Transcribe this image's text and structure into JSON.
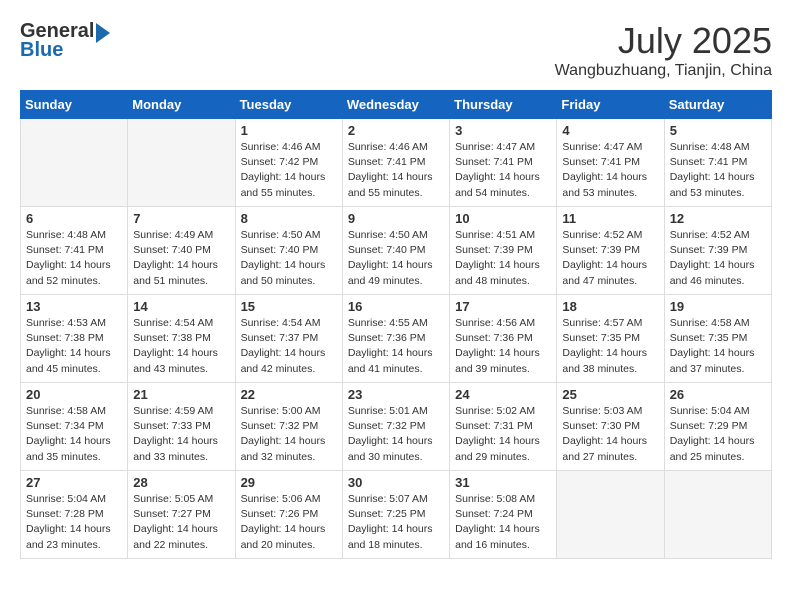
{
  "header": {
    "logo_general": "General",
    "logo_blue": "Blue",
    "month_title": "July 2025",
    "location": "Wangbuzhuang, Tianjin, China"
  },
  "weekdays": [
    "Sunday",
    "Monday",
    "Tuesday",
    "Wednesday",
    "Thursday",
    "Friday",
    "Saturday"
  ],
  "weeks": [
    [
      {
        "day": "",
        "info": ""
      },
      {
        "day": "",
        "info": ""
      },
      {
        "day": "1",
        "info": "Sunrise: 4:46 AM\nSunset: 7:42 PM\nDaylight: 14 hours\nand 55 minutes."
      },
      {
        "day": "2",
        "info": "Sunrise: 4:46 AM\nSunset: 7:41 PM\nDaylight: 14 hours\nand 55 minutes."
      },
      {
        "day": "3",
        "info": "Sunrise: 4:47 AM\nSunset: 7:41 PM\nDaylight: 14 hours\nand 54 minutes."
      },
      {
        "day": "4",
        "info": "Sunrise: 4:47 AM\nSunset: 7:41 PM\nDaylight: 14 hours\nand 53 minutes."
      },
      {
        "day": "5",
        "info": "Sunrise: 4:48 AM\nSunset: 7:41 PM\nDaylight: 14 hours\nand 53 minutes."
      }
    ],
    [
      {
        "day": "6",
        "info": "Sunrise: 4:48 AM\nSunset: 7:41 PM\nDaylight: 14 hours\nand 52 minutes."
      },
      {
        "day": "7",
        "info": "Sunrise: 4:49 AM\nSunset: 7:40 PM\nDaylight: 14 hours\nand 51 minutes."
      },
      {
        "day": "8",
        "info": "Sunrise: 4:50 AM\nSunset: 7:40 PM\nDaylight: 14 hours\nand 50 minutes."
      },
      {
        "day": "9",
        "info": "Sunrise: 4:50 AM\nSunset: 7:40 PM\nDaylight: 14 hours\nand 49 minutes."
      },
      {
        "day": "10",
        "info": "Sunrise: 4:51 AM\nSunset: 7:39 PM\nDaylight: 14 hours\nand 48 minutes."
      },
      {
        "day": "11",
        "info": "Sunrise: 4:52 AM\nSunset: 7:39 PM\nDaylight: 14 hours\nand 47 minutes."
      },
      {
        "day": "12",
        "info": "Sunrise: 4:52 AM\nSunset: 7:39 PM\nDaylight: 14 hours\nand 46 minutes."
      }
    ],
    [
      {
        "day": "13",
        "info": "Sunrise: 4:53 AM\nSunset: 7:38 PM\nDaylight: 14 hours\nand 45 minutes."
      },
      {
        "day": "14",
        "info": "Sunrise: 4:54 AM\nSunset: 7:38 PM\nDaylight: 14 hours\nand 43 minutes."
      },
      {
        "day": "15",
        "info": "Sunrise: 4:54 AM\nSunset: 7:37 PM\nDaylight: 14 hours\nand 42 minutes."
      },
      {
        "day": "16",
        "info": "Sunrise: 4:55 AM\nSunset: 7:36 PM\nDaylight: 14 hours\nand 41 minutes."
      },
      {
        "day": "17",
        "info": "Sunrise: 4:56 AM\nSunset: 7:36 PM\nDaylight: 14 hours\nand 39 minutes."
      },
      {
        "day": "18",
        "info": "Sunrise: 4:57 AM\nSunset: 7:35 PM\nDaylight: 14 hours\nand 38 minutes."
      },
      {
        "day": "19",
        "info": "Sunrise: 4:58 AM\nSunset: 7:35 PM\nDaylight: 14 hours\nand 37 minutes."
      }
    ],
    [
      {
        "day": "20",
        "info": "Sunrise: 4:58 AM\nSunset: 7:34 PM\nDaylight: 14 hours\nand 35 minutes."
      },
      {
        "day": "21",
        "info": "Sunrise: 4:59 AM\nSunset: 7:33 PM\nDaylight: 14 hours\nand 33 minutes."
      },
      {
        "day": "22",
        "info": "Sunrise: 5:00 AM\nSunset: 7:32 PM\nDaylight: 14 hours\nand 32 minutes."
      },
      {
        "day": "23",
        "info": "Sunrise: 5:01 AM\nSunset: 7:32 PM\nDaylight: 14 hours\nand 30 minutes."
      },
      {
        "day": "24",
        "info": "Sunrise: 5:02 AM\nSunset: 7:31 PM\nDaylight: 14 hours\nand 29 minutes."
      },
      {
        "day": "25",
        "info": "Sunrise: 5:03 AM\nSunset: 7:30 PM\nDaylight: 14 hours\nand 27 minutes."
      },
      {
        "day": "26",
        "info": "Sunrise: 5:04 AM\nSunset: 7:29 PM\nDaylight: 14 hours\nand 25 minutes."
      }
    ],
    [
      {
        "day": "27",
        "info": "Sunrise: 5:04 AM\nSunset: 7:28 PM\nDaylight: 14 hours\nand 23 minutes."
      },
      {
        "day": "28",
        "info": "Sunrise: 5:05 AM\nSunset: 7:27 PM\nDaylight: 14 hours\nand 22 minutes."
      },
      {
        "day": "29",
        "info": "Sunrise: 5:06 AM\nSunset: 7:26 PM\nDaylight: 14 hours\nand 20 minutes."
      },
      {
        "day": "30",
        "info": "Sunrise: 5:07 AM\nSunset: 7:25 PM\nDaylight: 14 hours\nand 18 minutes."
      },
      {
        "day": "31",
        "info": "Sunrise: 5:08 AM\nSunset: 7:24 PM\nDaylight: 14 hours\nand 16 minutes."
      },
      {
        "day": "",
        "info": ""
      },
      {
        "day": "",
        "info": ""
      }
    ]
  ]
}
